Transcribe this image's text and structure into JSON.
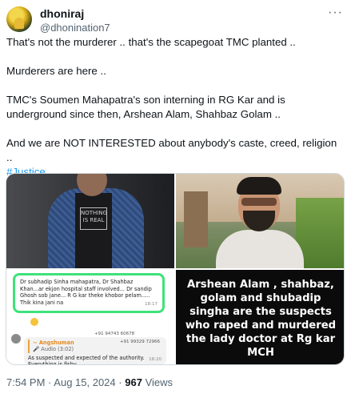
{
  "author": {
    "display_name": "dhoniraj",
    "handle": "@dhonination7",
    "more_label": "···"
  },
  "tweet": {
    "lines": [
      "That's not the murderer .. that's the scapegoat TMC planted ..",
      "",
      "Murderers are here ..",
      "",
      "TMC's Soumen Mahapatra's son interning in RG Kar and is underground since then, Arshean Alam, Shahbaz Golam ..",
      "",
      "And we are NOT INTERESTED about anybody's caste, creed, religion .."
    ],
    "hashtag": "#Justice"
  },
  "media": {
    "shirt_print": "NOTHING IS REAL",
    "chat": {
      "message1": "Dr subhadip Sinha mahapatra, Dr Shahbaz Khan...ar ekjon hospital staff involved... Dr sandip Ghosh sob jane... R G kar theke khobor pelam..... Thik kina jani na",
      "time1": "18:17",
      "phone1": "+91 94743 60678",
      "phone2": "+91 99329 72966",
      "quote_name": "~ Angshuman",
      "quote_audio": "🎤 Audio (3:02)",
      "message2": "As suspected and expected of the authority. Everything is fishy.",
      "time2": "18:20"
    },
    "caption": "Arshean Alam , shahbaz, golam and shubadip singha are the suspects who raped and murdered the lady doctor at Rg kar MCH"
  },
  "meta": {
    "time": "7:54 PM",
    "separator": "·",
    "date": "Aug 15, 2024",
    "views_count": "967",
    "views_label": "Views"
  }
}
